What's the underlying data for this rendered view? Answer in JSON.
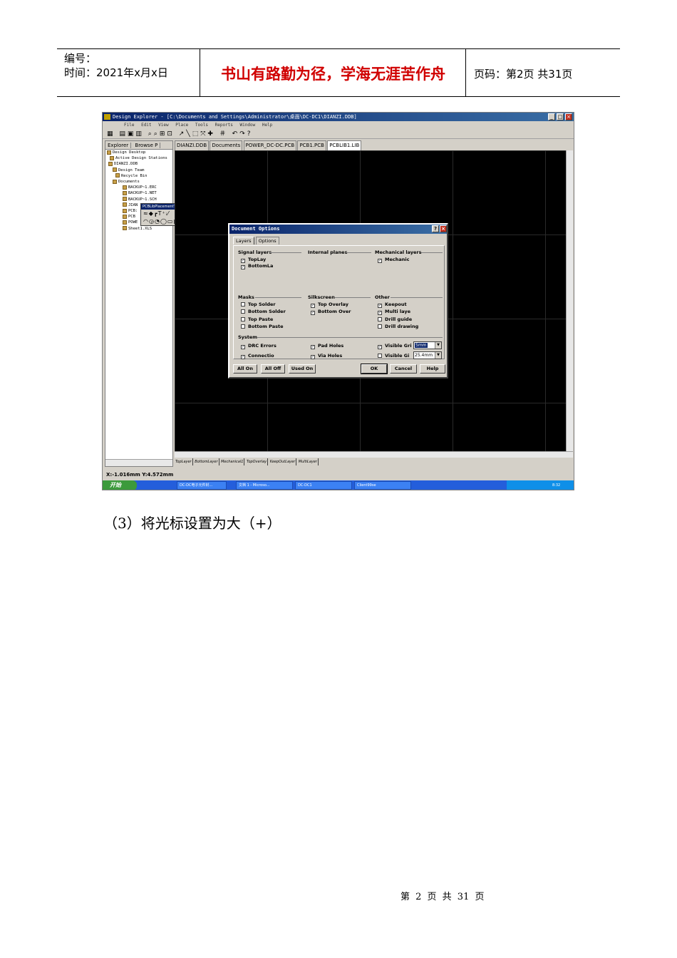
{
  "header": {
    "number_label": "编号：",
    "time_label": "时间：2021年x月x日",
    "motto": "书山有路勤为径，学海无涯苦作舟",
    "page_info": "页码：第2页  共31页"
  },
  "screenshot": {
    "window_title": "Design Explorer - [C:\\Documents and Settings\\Administrator\\桌面\\DC-DC1\\DIANZI.DDB]",
    "menu": [
      "File",
      "Edit",
      "View",
      "Place",
      "Tools",
      "Reports",
      "Window",
      "Help"
    ],
    "left_tabs": [
      "Explorer",
      "Browse P"
    ],
    "tree": [
      "Design Desktop",
      "Active Design Stations",
      "DIANZI.DDB",
      "Design Team",
      "Recycle Bin",
      "Documents",
      "BACKUP~1.ERC",
      "BACKUP~1.NET",
      "BACKUP~1.SCH",
      "JIAN",
      "PCB:",
      "PCB",
      "POWE",
      "Sheet1.XLS"
    ],
    "floating_toolbar_title": "PCBLibPlacementTools",
    "doc_tabs": [
      "DIANZI.DDB",
      "Documents",
      "POWER_DC-DC.PCB",
      "PCB1.PCB",
      "PCBLIB1.LIB"
    ],
    "layer_tabs": [
      "TopLayer",
      "BottomLayer",
      "Mechanical1",
      "TopOverlay",
      "KeepOutLayer",
      "MultiLayer"
    ],
    "status": "X:-1.016mm Y:4.572mm",
    "taskbar": {
      "start": "开始",
      "tasks": [
        "DC-DC电子元件封...",
        "文档 1 - Microso...",
        "DC-DC1",
        "Client99se"
      ],
      "clock": "8:32"
    },
    "dialog": {
      "title": "Document Options",
      "tabs": [
        "Layers",
        "Options"
      ],
      "groups": {
        "signal": "Signal layers",
        "internal": "Internal planes",
        "mechanical": "Mechanical layers",
        "masks": "Masks",
        "silkscreen": "Silkscreen",
        "other": "Other",
        "system": "System"
      },
      "checkboxes": {
        "top_layer": "TopLay",
        "bottom_layer": "BottomLa",
        "mechanical": "Mechanic",
        "top_solder": "Top Solder",
        "bottom_solder": "Bottom Solder",
        "top_paste": "Top Paste",
        "bottom_paste": "Bottom Paste",
        "top_overlay": "Top Overlay",
        "bottom_overlay": "Bottom Over",
        "keepout": "Keepout",
        "multi_layer": "Multi laye",
        "drill_guide": "Drill guide",
        "drill_drawing": "Drill drawing",
        "drc_errors": "DRC Errors",
        "connections": "Connectio",
        "pad_holes": "Pad Holes",
        "via_holes": "Via Holes",
        "visible_grid1": "Visible Gri",
        "visible_grid2": "Visible Gi"
      },
      "grid1_value": "5mm",
      "grid2_value": "25.4mm",
      "buttons": {
        "all_on": "All On",
        "all_off": "All Off",
        "used_on": "Used On",
        "ok": "OK",
        "cancel": "Cancel",
        "help": "Help"
      }
    }
  },
  "caption": "（3）将光标设置为大（+）",
  "footer": "第 2 页 共 31 页"
}
